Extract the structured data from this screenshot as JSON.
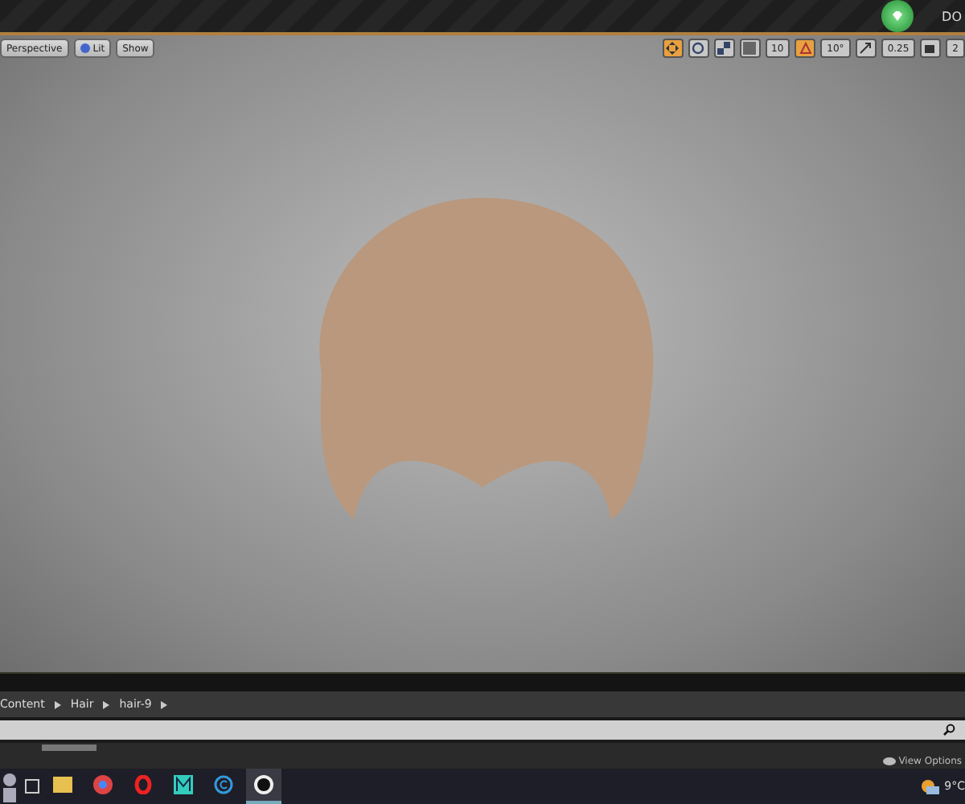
{
  "title_bar": {
    "user_label": "DO"
  },
  "viewport_toolbar": {
    "view_buttons": [
      {
        "label": "Perspective",
        "kind": "menu"
      },
      {
        "label": "Lit",
        "kind": "lit"
      },
      {
        "label": "Show",
        "kind": "menu"
      }
    ],
    "transform_tools": [
      {
        "kind": "move",
        "selected": true
      },
      {
        "kind": "rotate",
        "selected": false
      },
      {
        "kind": "scale",
        "selected": false
      }
    ],
    "snaps": [
      {
        "kind": "grid",
        "value": "10",
        "on": false
      },
      {
        "kind": "angle",
        "value": "10°",
        "on": true
      },
      {
        "kind": "scale",
        "value": "0.25",
        "on": false
      },
      {
        "kind": "camera",
        "value": "2",
        "on": false
      }
    ]
  },
  "content_browser": {
    "breadcrumbs": [
      "Content",
      "Hair",
      "hair-9"
    ],
    "view_options": "View Options"
  },
  "taskbar": {
    "apps": [
      {
        "kind": "files",
        "active": false
      },
      {
        "kind": "chrome",
        "active": false
      },
      {
        "kind": "opera",
        "active": false
      },
      {
        "kind": "m",
        "active": false
      },
      {
        "kind": "c",
        "active": false
      },
      {
        "kind": "unreal",
        "active": true
      }
    ],
    "temperature": "9°C"
  }
}
